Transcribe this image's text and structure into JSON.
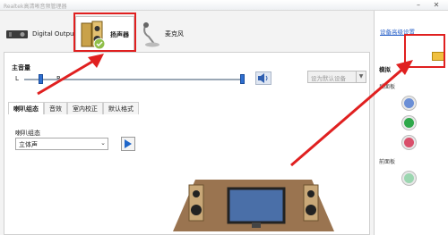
{
  "window": {
    "title": "Realtek高清晰音频管理器"
  },
  "device_tabs": [
    {
      "label": "Digital Output"
    },
    {
      "label": "扬声器"
    },
    {
      "label": "麦克风"
    }
  ],
  "volume": {
    "label": "主音量",
    "left_label": "L",
    "right_label": "R",
    "balance_fraction": 0.5,
    "volume_fraction": 1.0,
    "default_device_label": "设为默认设备"
  },
  "sub_tabs": [
    "喇叭组态",
    "音效",
    "室内校正",
    "默认格式"
  ],
  "config": {
    "label": "喇叭组态",
    "selected": "立体声"
  },
  "side": {
    "advanced_link": "设备高级设置",
    "section_title": "模拟",
    "rear_label": "后面板",
    "front_label": "前面板",
    "jacks": [
      {
        "color": "#6b8fd6"
      },
      {
        "color": "#2ea84a"
      },
      {
        "color": "#d94f6b"
      },
      {
        "color": "#9bd6b0"
      }
    ]
  },
  "colors": {
    "highlight": "#e02020",
    "accent": "#1f66c9"
  }
}
